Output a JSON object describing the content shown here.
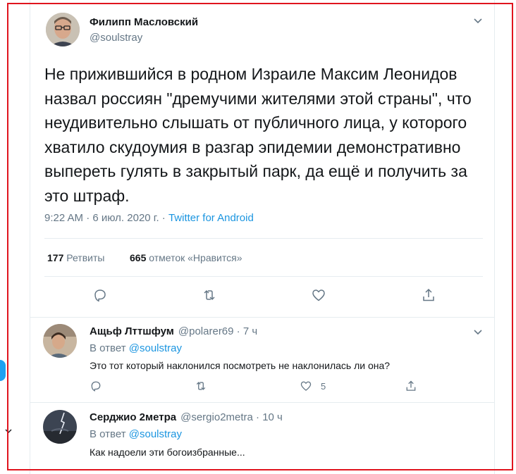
{
  "colors": {
    "accent": "#1b95e0",
    "frame": "#e0141e",
    "muted": "#657786",
    "text": "#14171a"
  },
  "tweet": {
    "author_name": "Филипп Масловский",
    "author_handle": "@soulstray",
    "text": "Не прижившийся в родном Израиле Максим Леонидов назвал россиян \"дремучими жителями этой страны\", что неудивительно слышать от публичного лица, у которого хватило скудоумия в разгар эпидемии демонстративно выпереть гулять в закрытый парк, да ещё и получить за это штраф.",
    "time": "9:22 AM · 6 июл. 2020 г. · ",
    "source": "Twitter for Android",
    "retweets_count": "177",
    "retweets_label": "Ретвиты",
    "likes_count": "665",
    "likes_label": "отметок «Нравится»",
    "icons": [
      "reply-icon",
      "retweet-icon",
      "like-icon",
      "share-icon",
      "chevron-down-icon"
    ]
  },
  "replies": [
    {
      "name": "Ащьф Лттшфум",
      "handle": "@polarer69 · 7 ч",
      "reply_prefix": "В ответ ",
      "reply_to": "@soulstray",
      "text": "Это тот который наклонился посмотреть не наклонилась ли она?",
      "likes": "5"
    },
    {
      "name": "Серджио 2метра",
      "handle": "@sergio2metra · 10 ч",
      "reply_prefix": "В ответ ",
      "reply_to": "@soulstray",
      "text": "Как надоели эти богоизбранные..."
    }
  ]
}
